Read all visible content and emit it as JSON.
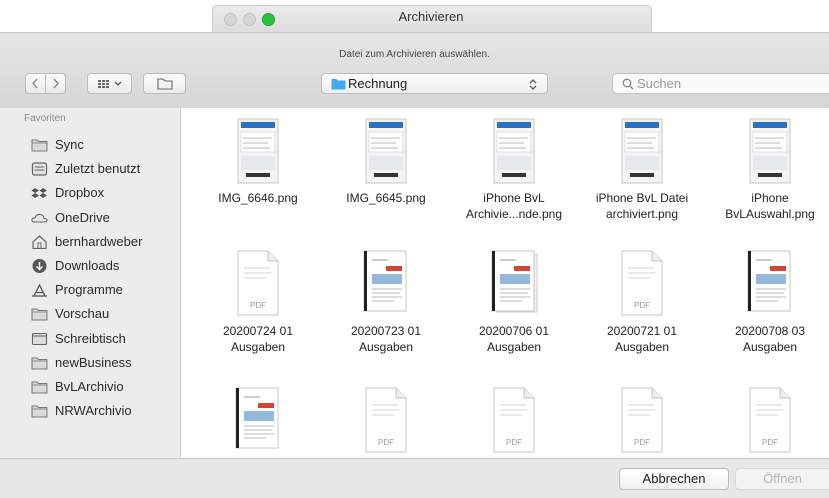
{
  "window": {
    "title": "Archivieren"
  },
  "header": {
    "prompt": "Datei zum Archivieren auswählen.",
    "location": "Rechnung",
    "search_placeholder": "Suchen"
  },
  "sidebar": {
    "heading": "Favoriten",
    "items": [
      {
        "label": "Sync",
        "icon": "folder-icon"
      },
      {
        "label": "Zuletzt benutzt",
        "icon": "recents-icon"
      },
      {
        "label": "Dropbox",
        "icon": "dropbox-icon"
      },
      {
        "label": "OneDrive",
        "icon": "cloud-icon"
      },
      {
        "label": "bernhardweber",
        "icon": "home-icon"
      },
      {
        "label": "Downloads",
        "icon": "downloads-icon"
      },
      {
        "label": "Programme",
        "icon": "applications-icon"
      },
      {
        "label": "Vorschau",
        "icon": "folder-icon"
      },
      {
        "label": "Schreibtisch",
        "icon": "desktop-icon"
      },
      {
        "label": "newBusiness",
        "icon": "folder-icon"
      },
      {
        "label": "BvLArchivio",
        "icon": "folder-icon"
      },
      {
        "label": "NRWArchivio",
        "icon": "folder-icon"
      }
    ]
  },
  "files": [
    {
      "line1": "IMG_6646.png",
      "line2": "",
      "kind": "phone"
    },
    {
      "line1": "IMG_6645.png",
      "line2": "",
      "kind": "phone"
    },
    {
      "line1": "iPhone BvL",
      "line2": "Archivie...nde.png",
      "kind": "phone"
    },
    {
      "line1": "iPhone BvL Datei",
      "line2": "archiviert.png",
      "kind": "phone"
    },
    {
      "line1": "iPhone",
      "line2": "BvLAuswahl.png",
      "kind": "phone"
    },
    {
      "line1": "20200724 01",
      "line2": "Ausgaben",
      "kind": "pdf-plain"
    },
    {
      "line1": "20200723 01",
      "line2": "Ausgaben",
      "kind": "invoice"
    },
    {
      "line1": "20200706 01",
      "line2": "Ausgaben",
      "kind": "invoice-stack"
    },
    {
      "line1": "20200721 01",
      "line2": "Ausgaben",
      "kind": "pdf-plain"
    },
    {
      "line1": "20200708 03",
      "line2": "Ausgaben",
      "kind": "invoice"
    },
    {
      "line1": "",
      "line2": "",
      "kind": "invoice"
    },
    {
      "line1": "",
      "line2": "",
      "kind": "pdf-plain"
    },
    {
      "line1": "",
      "line2": "",
      "kind": "pdf-plain"
    },
    {
      "line1": "",
      "line2": "",
      "kind": "pdf-plain"
    },
    {
      "line1": "",
      "line2": "",
      "kind": "pdf-plain"
    }
  ],
  "pdf_badge": "PDF",
  "footer": {
    "cancel_label": "Abbrechen",
    "open_label": "Öffnen"
  },
  "colors": {
    "accent_green": "#29c23f",
    "folder_blue": "#3fa9f5"
  }
}
